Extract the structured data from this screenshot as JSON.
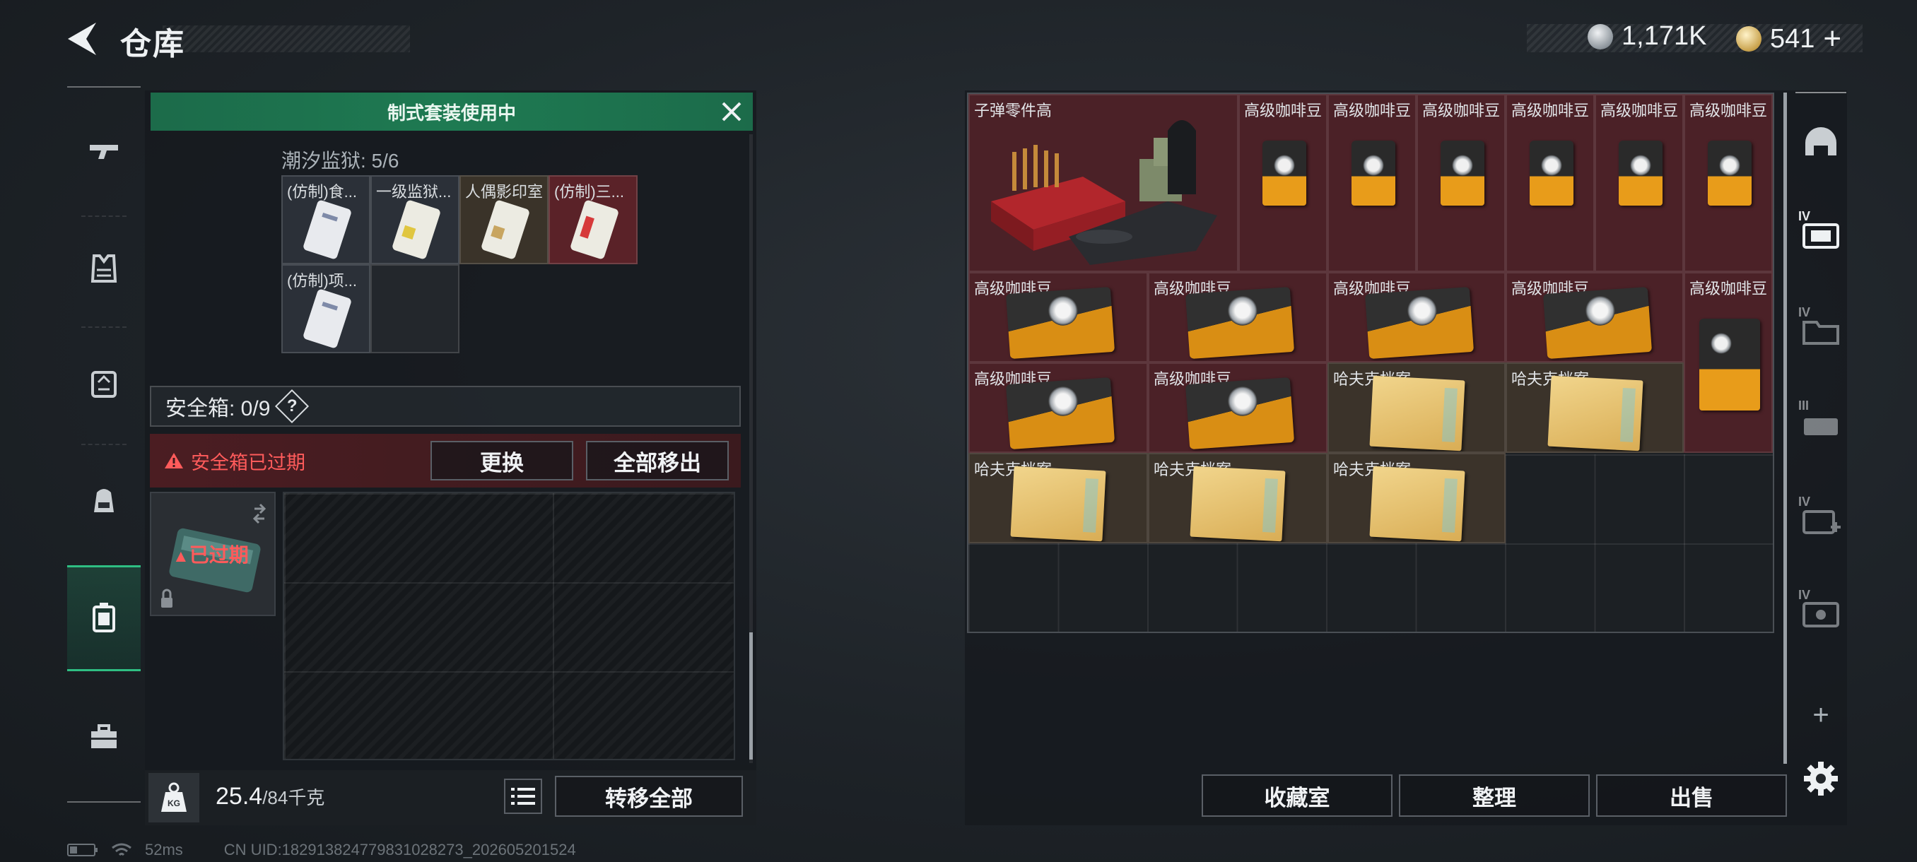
{
  "header": {
    "title": "仓库"
  },
  "currency": {
    "silver": "1,171K",
    "gold": "541",
    "gold_plus": "+"
  },
  "loadout_banner": {
    "text": "制式套装使用中"
  },
  "collection": {
    "label": "潮汐监狱: 5/6",
    "cards": [
      {
        "label": "(仿制)食...",
        "bg": "gray"
      },
      {
        "label": "一级监狱...",
        "bg": "gray"
      },
      {
        "label": "人偶影印室",
        "bg": "brown"
      },
      {
        "label": "(仿制)三...",
        "bg": "red"
      },
      {
        "label": "(仿制)项...",
        "bg": "gray"
      }
    ]
  },
  "safebox": {
    "label": "安全箱: 0/9",
    "help": "?",
    "expired_text": "安全箱已过期",
    "replace_button": "更换",
    "remove_all_button": "全部移出",
    "tile_status": "已过期"
  },
  "weight": {
    "current": "25.4",
    "max": "/84千克"
  },
  "transfer_all_button": "转移全部",
  "inventory": {
    "items": [
      {
        "label": "子弹零件高",
        "type": "ammo",
        "bg": "red"
      },
      {
        "label": "高级咖啡豆",
        "type": "bag",
        "bg": "red"
      },
      {
        "label": "高级咖啡豆",
        "type": "bag",
        "bg": "red"
      },
      {
        "label": "高级咖啡豆",
        "type": "bag",
        "bg": "red"
      },
      {
        "label": "高级咖啡豆",
        "type": "bag",
        "bg": "red"
      },
      {
        "label": "高级咖啡豆",
        "type": "bag",
        "bg": "red"
      },
      {
        "label": "高级咖啡豆",
        "type": "bag",
        "bg": "red"
      },
      {
        "label": "高级咖啡豆",
        "type": "tin",
        "bg": "red"
      },
      {
        "label": "高级咖啡豆",
        "type": "tin",
        "bg": "red"
      },
      {
        "label": "高级咖啡豆",
        "type": "tin",
        "bg": "red"
      },
      {
        "label": "高级咖啡豆",
        "type": "tin",
        "bg": "red"
      },
      {
        "label": "高级咖啡豆",
        "type": "bag",
        "bg": "red"
      },
      {
        "label": "高级咖啡豆",
        "type": "tin",
        "bg": "red"
      },
      {
        "label": "高级咖啡豆",
        "type": "tin",
        "bg": "red"
      },
      {
        "label": "哈夫克档案",
        "type": "folder",
        "bg": "brown"
      },
      {
        "label": "哈夫克档案",
        "type": "folder",
        "bg": "brown"
      },
      {
        "label": "哈夫克档案",
        "type": "folder",
        "bg": "brown"
      },
      {
        "label": "哈夫克档案",
        "type": "folder",
        "bg": "brown"
      },
      {
        "label": "哈夫克档案",
        "type": "folder",
        "bg": "brown"
      }
    ]
  },
  "bottom_buttons": {
    "collection_room": "收藏室",
    "organize": "整理",
    "sell": "出售"
  },
  "right_tabs": [
    {
      "icon": "helmet-icon",
      "num": ""
    },
    {
      "icon": "case-icon",
      "num": "IV"
    },
    {
      "icon": "folder-case-icon",
      "num": "IV"
    },
    {
      "icon": "case-icon",
      "num": "III"
    },
    {
      "icon": "medical-case-icon",
      "num": "IV"
    },
    {
      "icon": "case-icon",
      "num": "IV"
    }
  ],
  "add_tab": "+",
  "status_bar": {
    "ping": "52ms",
    "uid": "CN UID:1829138247798310282​73_202605201524"
  },
  "colors": {
    "accent_green": "#2fbf83",
    "banner_green": "#1e7a52",
    "warning_red": "#ff5b5b",
    "item_red_bg": "#4b2127"
  }
}
